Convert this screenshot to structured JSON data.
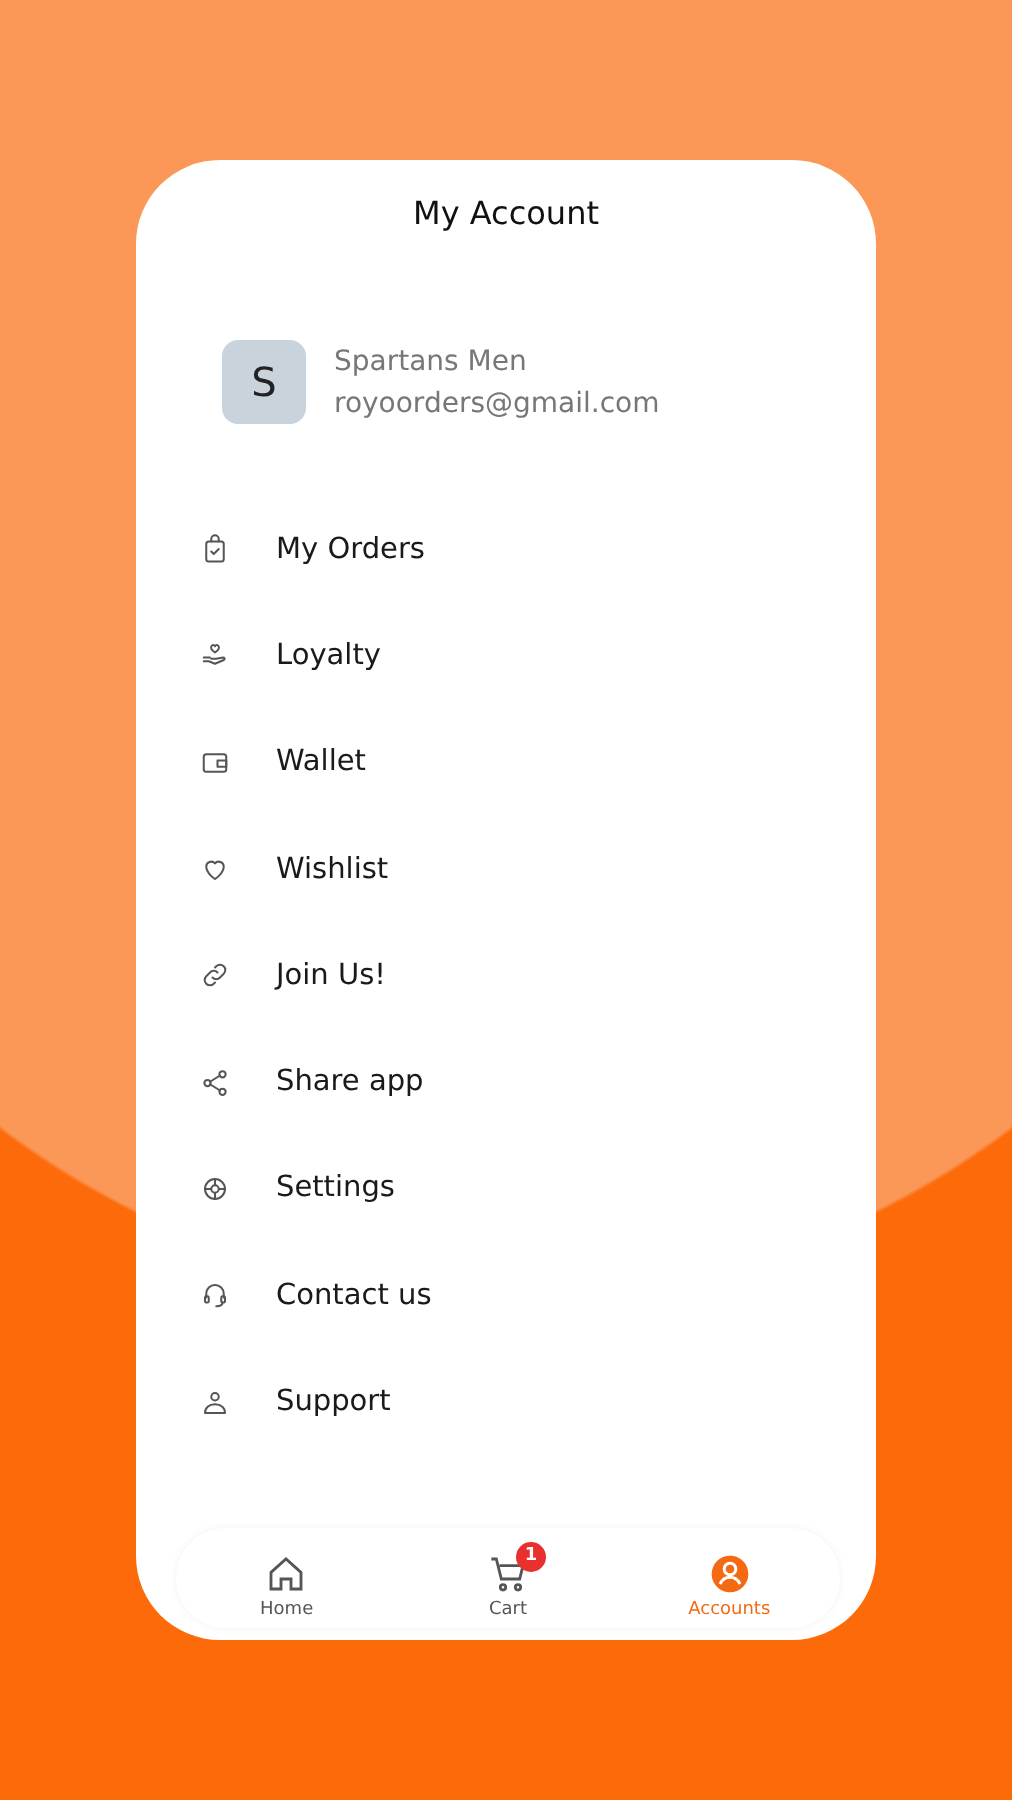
{
  "header": {
    "title": "My Account"
  },
  "profile": {
    "initial": "S",
    "name": "Spartans Men",
    "email": "royoorders@gmail.com"
  },
  "menu": [
    {
      "kind": "orders",
      "label": "My Orders"
    },
    {
      "kind": "loyalty",
      "label": "Loyalty"
    },
    {
      "kind": "wallet",
      "label": "Wallet"
    },
    {
      "kind": "wishlist",
      "label": "Wishlist"
    },
    {
      "kind": "join",
      "label": "Join Us!"
    },
    {
      "kind": "share",
      "label": "Share app"
    },
    {
      "kind": "settings",
      "label": "Settings"
    },
    {
      "kind": "contact",
      "label": "Contact us"
    },
    {
      "kind": "support",
      "label": "Support"
    }
  ],
  "bottom_nav": [
    {
      "kind": "home",
      "label": "Home",
      "selected": false
    },
    {
      "kind": "cart",
      "label": "Cart",
      "selected": false,
      "badge": "1"
    },
    {
      "kind": "account",
      "label": "Accounts",
      "selected": true
    }
  ]
}
